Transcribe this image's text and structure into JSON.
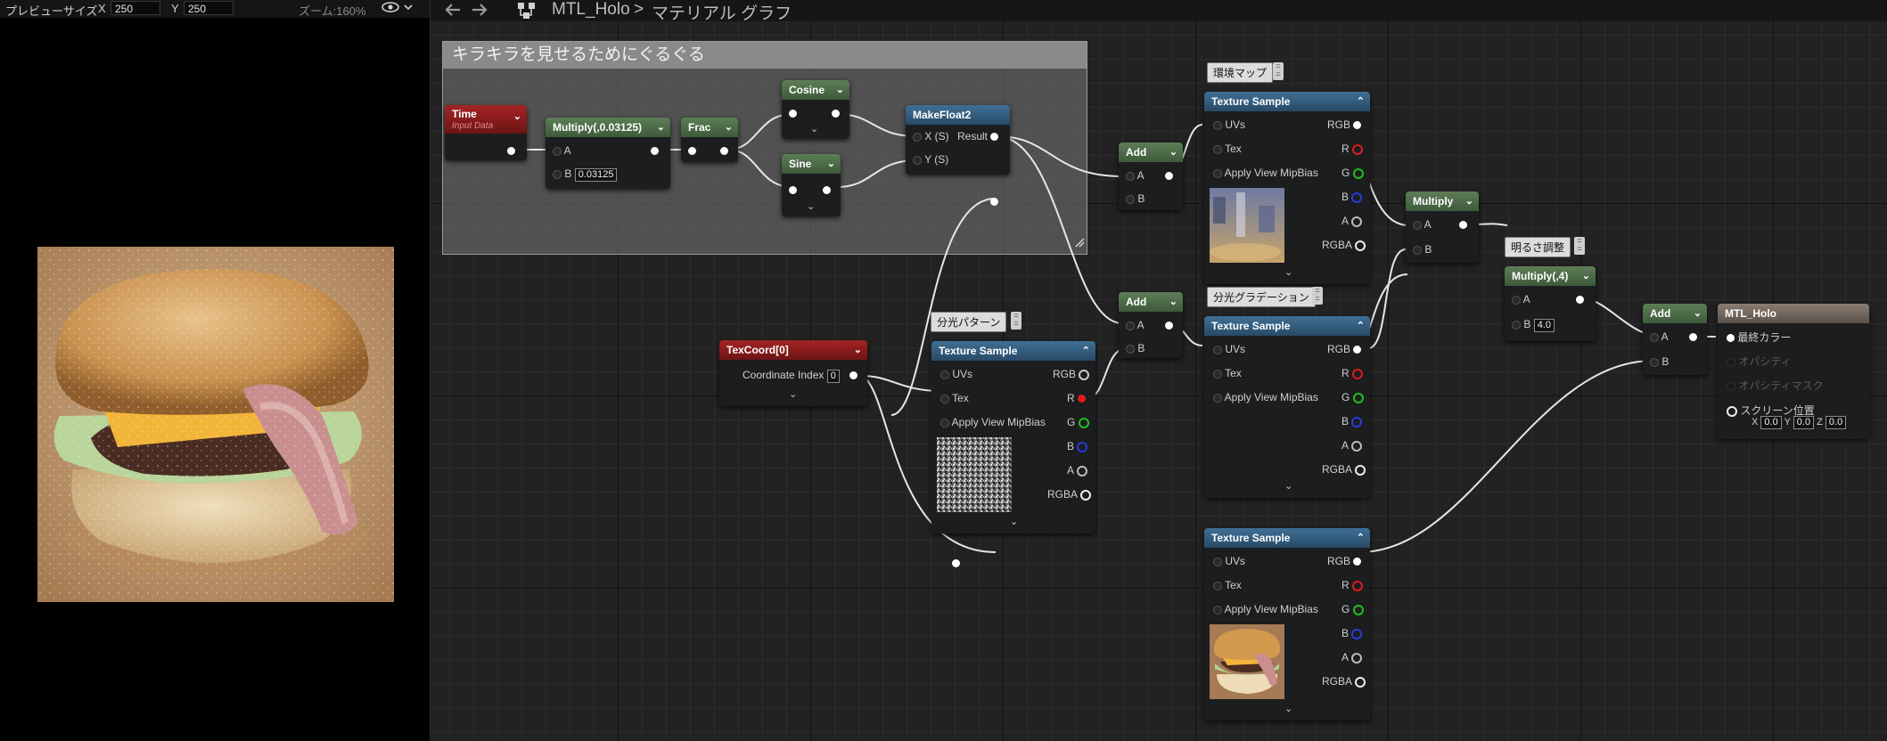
{
  "preview": {
    "size_label": "プレビューサイズ",
    "x_label": "X",
    "x_value": "250",
    "y_label": "Y",
    "y_value": "250",
    "zoom": "ズーム:160%"
  },
  "breadcrumb": {
    "asset": "MTL_Holo",
    "separator": ">",
    "graph": "マテリアル グラフ"
  },
  "comment_title": "キラキラを見せるためにぐるぐる",
  "nodes": {
    "time": {
      "title": "Time",
      "subtitle": "Input Data"
    },
    "multiply1": {
      "title": "Multiply(,0.03125)",
      "pin_a": "A",
      "pin_b": "B",
      "b_value": "0.03125"
    },
    "frac": {
      "title": "Frac"
    },
    "cosine": {
      "title": "Cosine"
    },
    "sine": {
      "title": "Sine"
    },
    "makefloat2": {
      "title": "MakeFloat2",
      "pin_x": "X (S)",
      "pin_y": "Y (S)",
      "out": "Result"
    },
    "add1": {
      "title": "Add",
      "pin_a": "A",
      "pin_b": "B"
    },
    "add2": {
      "title": "Add",
      "pin_a": "A",
      "pin_b": "B"
    },
    "texcoord": {
      "title": "TexCoord[0]",
      "pin": "Coordinate Index",
      "value": "0"
    },
    "ts_pattern": {
      "title": "Texture Sample",
      "tag": "分光パターン"
    },
    "ts_env": {
      "title": "Texture Sample",
      "tag": "環境マップ"
    },
    "ts_grad": {
      "title": "Texture Sample",
      "tag": "分光グラデーション"
    },
    "ts_burger": {
      "title": "Texture Sample"
    },
    "multiply2": {
      "title": "Multiply",
      "pin_a": "A",
      "pin_b": "B"
    },
    "multiply3": {
      "title": "Multiply(,4)",
      "tag": "明るさ調整",
      "pin_a": "A",
      "pin_b": "B",
      "b_value": "4.0"
    },
    "add3": {
      "title": "Add",
      "pin_a": "A",
      "pin_b": "B"
    },
    "output": {
      "title": "MTL_Holo",
      "pin_final": "最終カラー",
      "pin_opacity": "オパシティ",
      "pin_opacity_mask": "オパシティマスク",
      "pin_screen": "スクリーン位置",
      "x_label": "X",
      "x": "0.0",
      "y_label": "Y",
      "y": "0.0",
      "z_label": "Z",
      "z": "0.0"
    }
  },
  "texture_pins": {
    "uvs": "UVs",
    "tex": "Tex",
    "mip": "Apply View MipBias",
    "rgb": "RGB",
    "r": "R",
    "g": "G",
    "b": "B",
    "a": "A",
    "rgba": "RGBA"
  },
  "colors": {
    "node_green": "#4a6b46",
    "node_red": "#8a1c1c",
    "node_blue": "#34607f",
    "pin_r": "#e01b1b",
    "pin_g": "#1ec21e",
    "pin_b": "#2a3bd8"
  }
}
